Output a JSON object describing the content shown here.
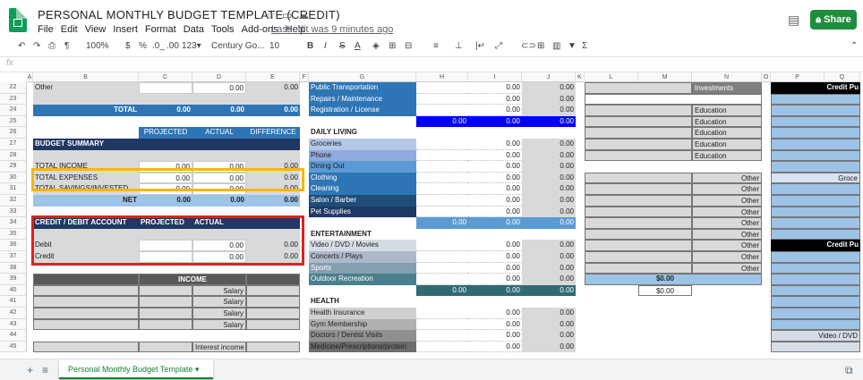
{
  "doc": {
    "title": "PERSONAL MONTHLY BUDGET TEMPLATE (CREDIT)",
    "last_edit": "Last edit was 9 minutes ago",
    "share": "Share"
  },
  "menu": [
    "File",
    "Edit",
    "View",
    "Insert",
    "Format",
    "Data",
    "Tools",
    "Add-ons",
    "Help"
  ],
  "toolbar": {
    "zoom": "100%",
    "currency": "$",
    "percent": "%",
    "dec_less": ".0_",
    "dec_more": ".00",
    "format": "123▾",
    "font": "Century Go...",
    "size": "10",
    "bold": "B",
    "italic": "I",
    "strike": "S",
    "textcolor": "A"
  },
  "fx": "fx",
  "columns": [
    "A",
    "B",
    "C",
    "D",
    "E",
    "F",
    "G",
    "H",
    "I",
    "J",
    "K",
    "L",
    "M",
    "N",
    "O",
    "P",
    "Q"
  ],
  "rows": [
    "22",
    "23",
    "24",
    "25",
    "26",
    "27",
    "28",
    "29",
    "30",
    "31",
    "32",
    "33",
    "34",
    "35",
    "36",
    "37",
    "38",
    "39",
    "40",
    "41",
    "42",
    "43",
    "44",
    "45"
  ],
  "left": {
    "other": "Other",
    "other_val": "0.00",
    "other_e": "0.00",
    "total": "TOTAL",
    "total_c": "0.00",
    "total_d": "0.00",
    "total_e": "0.00",
    "h_projected": "PROJECTED",
    "h_actual": "ACTUAL",
    "h_difference": "DIFFERENCE",
    "budget_summary": "BUDGET SUMMARY",
    "total_income": "TOTAL INCOME",
    "ti_c": "0.00",
    "ti_d": "0.00",
    "ti_e": "0.00",
    "total_expenses": "TOTAL EXPENSES",
    "te_c": "0.00",
    "te_d": "0.00",
    "te_e": "0.00",
    "total_savings": "TOTAL SAVINGS/INVESTED",
    "ts_c": "0.00",
    "ts_d": "0.00",
    "ts_e": "0.00",
    "net": "NET",
    "net_c": "0.00",
    "net_d": "0.00",
    "net_e": "0.00",
    "cd_account": "CREDIT / DEBIT ACCOUNT",
    "cd_projected": "PROJECTED",
    "cd_actual": "ACTUAL",
    "debit": "Debit",
    "debit_d": "0.00",
    "debit_e": "0.00",
    "credit": "Credit",
    "credit_d": "0.00",
    "credit_e": "0.00",
    "income": "INCOME",
    "salary": "Salary",
    "interest": "Interest income"
  },
  "mid": [
    {
      "label": "Public Transportation",
      "i": "0.00",
      "j": "0.00"
    },
    {
      "label": "Repairs / Maintenance",
      "i": "0.00",
      "j": "0.00"
    },
    {
      "label": "Registration / License",
      "i": "0.00",
      "j": "0.00"
    },
    {
      "label": "",
      "h": "0.00",
      "i": "0.00",
      "j": "0.00"
    },
    {
      "label": "DAILY LIVING"
    },
    {
      "label": "Groceries",
      "i": "0.00",
      "j": "0.00"
    },
    {
      "label": "Phone",
      "i": "0.00",
      "j": "0.00"
    },
    {
      "label": "Dining Out",
      "i": "0.00",
      "j": "0.00"
    },
    {
      "label": "Clothing",
      "i": "0.00",
      "j": "0.00"
    },
    {
      "label": "Cleaning",
      "i": "0.00",
      "j": "0.00"
    },
    {
      "label": "Salon / Barber",
      "i": "0.00",
      "j": "0.00"
    },
    {
      "label": "Pet Supplies",
      "i": "0.00",
      "j": "0.00"
    },
    {
      "label": "",
      "h": "0.00",
      "i": "0.00",
      "j": "0.00"
    },
    {
      "label": "ENTERTAINMENT"
    },
    {
      "label": "Video / DVD / Movies",
      "i": "0.00",
      "j": "0.00"
    },
    {
      "label": "Concerts / Plays",
      "i": "0.00",
      "j": "0.00"
    },
    {
      "label": "Sports",
      "i": "0.00",
      "j": "0.00"
    },
    {
      "label": "Outdoor Recreation",
      "i": "0.00",
      "j": "0.00"
    },
    {
      "label": "",
      "h": "0.00",
      "i": "0.00",
      "j": "0.00"
    },
    {
      "label": "HEALTH"
    },
    {
      "label": "Health Insurance",
      "i": "0.00",
      "j": "0.00"
    },
    {
      "label": "Gym Membership",
      "i": "0.00",
      "j": "0.00"
    },
    {
      "label": "Doctors / Dentist Visits",
      "i": "0.00",
      "j": "0.00"
    },
    {
      "label": "Medicine/Prescriptions/protein",
      "i": "0.00",
      "j": "0.00"
    }
  ],
  "right": {
    "investments": "Investments",
    "education": "Education",
    "other": "Other",
    "m_total1": "$0.00",
    "m_total2": "$0.00",
    "credit_pu": "Credit Pu",
    "groce": "Groce",
    "video": "Video / DVD"
  },
  "sheet_tab": "Personal Monthly Budget Template"
}
